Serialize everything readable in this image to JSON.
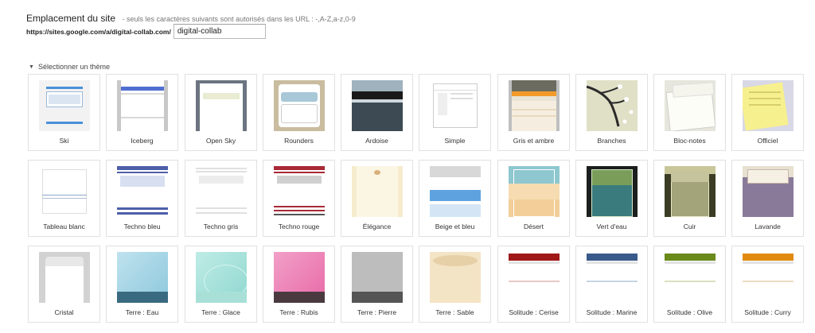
{
  "site_location": {
    "label": "Emplacement du site",
    "hint": "- seuls les caractères suivants sont autorisés dans les URL : -,A-Z,a-z,0-9",
    "url_prefix": "https://sites.google.com/a/digital-collab.com/",
    "value": "digital-collab"
  },
  "theme_section": {
    "heading": "Sélectionner un thème"
  },
  "themes": [
    {
      "name": "Ski"
    },
    {
      "name": "Iceberg"
    },
    {
      "name": "Open Sky"
    },
    {
      "name": "Rounders"
    },
    {
      "name": "Ardoise"
    },
    {
      "name": "Simple"
    },
    {
      "name": "Gris et ambre"
    },
    {
      "name": "Branches"
    },
    {
      "name": "Bloc-notes"
    },
    {
      "name": "Officiel"
    },
    {
      "name": "Tableau blanc"
    },
    {
      "name": "Techno bleu"
    },
    {
      "name": "Techno gris"
    },
    {
      "name": "Techno rouge"
    },
    {
      "name": "Élégance"
    },
    {
      "name": "Beige et bleu"
    },
    {
      "name": "Désert"
    },
    {
      "name": "Vert d'eau"
    },
    {
      "name": "Cuir"
    },
    {
      "name": "Lavande"
    },
    {
      "name": "Cristal"
    },
    {
      "name": "Terre : Eau"
    },
    {
      "name": "Terre : Glace"
    },
    {
      "name": "Terre : Rubis"
    },
    {
      "name": "Terre : Pierre"
    },
    {
      "name": "Terre : Sable"
    },
    {
      "name": "Solitude : Cerise"
    },
    {
      "name": "Solitude : Marine"
    },
    {
      "name": "Solitude : Olive"
    },
    {
      "name": "Solitude : Curry"
    }
  ]
}
